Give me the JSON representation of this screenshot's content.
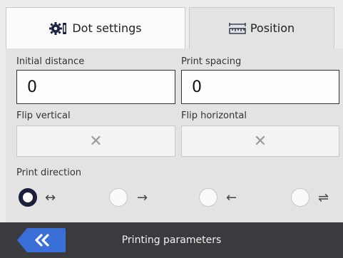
{
  "tabs": [
    {
      "label": "Dot settings",
      "icon": "gear-icon",
      "active": false
    },
    {
      "label": "Position",
      "icon": "ruler-icon",
      "active": true
    }
  ],
  "fields": {
    "initial_distance": {
      "label": "Initial distance",
      "value": "0"
    },
    "print_spacing": {
      "label": "Print spacing",
      "value": "0"
    }
  },
  "toggles": {
    "flip_vertical": {
      "label": "Flip vertical",
      "symbol": "✕"
    },
    "flip_horizontal": {
      "label": "Flip horizontal",
      "symbol": "✕"
    }
  },
  "print_direction": {
    "label": "Print direction",
    "options": [
      {
        "symbol": "↔",
        "selected": true
      },
      {
        "symbol": "→",
        "selected": false
      },
      {
        "symbol": "←",
        "selected": false
      },
      {
        "symbol": "⇌",
        "selected": false
      }
    ]
  },
  "footer": {
    "back_icon": "double-chevron-left-icon",
    "title": "Printing parameters"
  },
  "colors": {
    "back_button": "#3a6fd8",
    "footer": "#3b3b3f",
    "radio_selected": "#1a1f3c"
  }
}
